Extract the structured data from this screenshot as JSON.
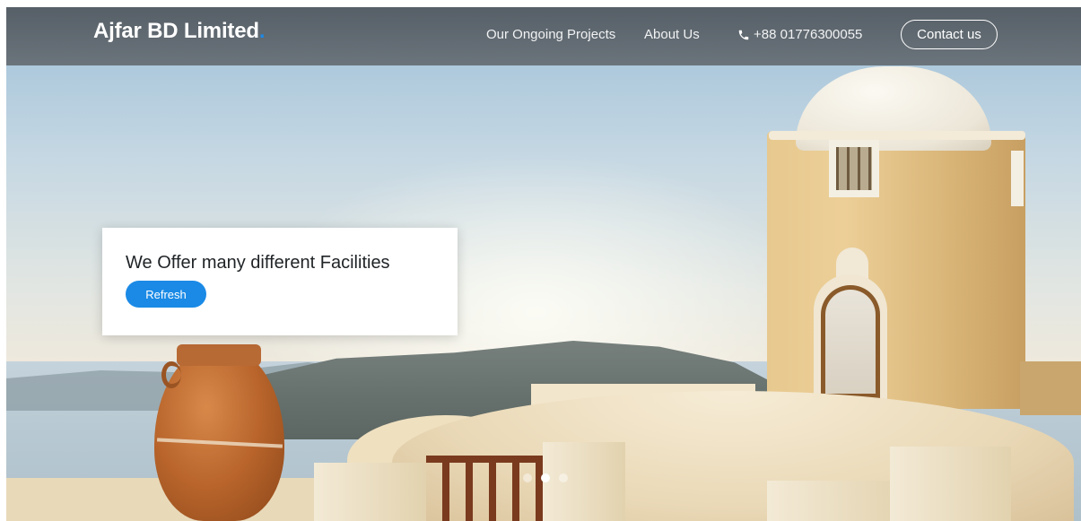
{
  "navbar": {
    "brand": "Ajfar BD Limited",
    "brand_dot": ".",
    "links": [
      {
        "label": "Our Ongoing Projects"
      },
      {
        "label": "About Us"
      }
    ],
    "phone": "+88 01776300055",
    "contact_label": "Contact us"
  },
  "hero": {
    "caption_title": "We Offer many different Facilities",
    "caption_button": "Refresh",
    "slides_count": 3,
    "active_slide": 2
  },
  "colors": {
    "accent": "#1a8ae6",
    "navbar_bg": "#585c60",
    "card_bg": "#ffffff"
  },
  "icons": {
    "phone": "phone-icon"
  }
}
